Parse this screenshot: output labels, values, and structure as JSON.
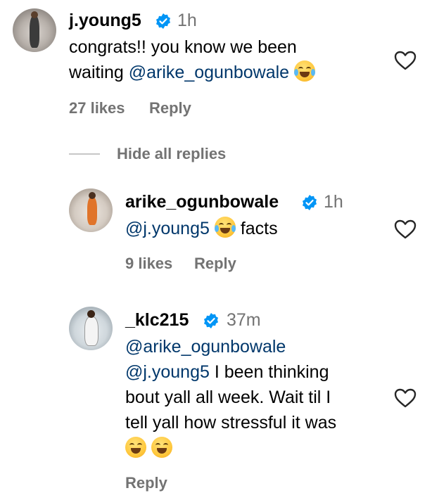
{
  "comments": [
    {
      "username": "j.young5",
      "time": "1h",
      "text_lines": [
        {
          "plain": "congrats!! you know we been",
          "mention": ""
        },
        {
          "plain": "waiting ",
          "mention": "@arike_ogunbowale"
        }
      ],
      "likes": "27 likes",
      "reply_label": "Reply"
    },
    {
      "username": "arike_ogunbowale",
      "time": "1h",
      "mention": "@j.young5",
      "after_text": "facts",
      "likes": "9 likes",
      "reply_label": "Reply"
    },
    {
      "username": "_klc215",
      "time": "37m",
      "lines": [
        "@arike_ogunbowale",
        "@j.young5",
        " I been thinking",
        "bout yall all week. Wait til I",
        "tell yall how stressful it was"
      ],
      "reply_label": "Reply"
    }
  ],
  "hide_replies_label": "Hide all replies",
  "colors": {
    "mention": "#00376b",
    "muted": "#737373",
    "verified": "#0095f6"
  },
  "icons": [
    "verified-badge-icon",
    "heart-icon",
    "face-with-tears-of-joy-emoji",
    "grinning-squinting-face-emoji"
  ]
}
